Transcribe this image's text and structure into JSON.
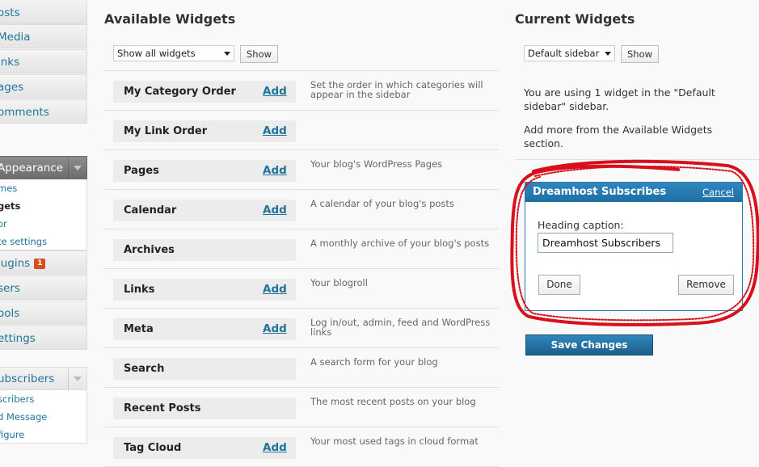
{
  "sidebar": {
    "items_top": [
      {
        "label": "Posts",
        "visible": "osts"
      },
      {
        "label": "Media",
        "visible": "Media"
      },
      {
        "label": "Links",
        "visible": "inks"
      },
      {
        "label": "Pages",
        "visible": "ages"
      },
      {
        "label": "Comments",
        "visible": "omments"
      }
    ],
    "appearance": {
      "label": "Appearance",
      "sub": [
        "mes",
        "gets",
        "or",
        "te settings"
      ]
    },
    "items_mid": [
      {
        "label": "Plugins",
        "visible": "lugins",
        "badge": "1"
      },
      {
        "label": "Users",
        "visible": "sers"
      },
      {
        "label": "Tools",
        "visible": "ools"
      },
      {
        "label": "Settings",
        "visible": "ettings"
      }
    ],
    "subscribers": {
      "label": "ubscribers",
      "sub": [
        "scribers",
        "d Message",
        "figure"
      ]
    }
  },
  "available": {
    "title": "Available Widgets",
    "filter_value": "Show all widgets",
    "show_label": "Show",
    "widgets": [
      {
        "name": "My Category Order",
        "add": "Add",
        "desc": "Set the order in which categories will appear in the sidebar"
      },
      {
        "name": "My Link Order",
        "add": "Add",
        "desc": ""
      },
      {
        "name": "Pages",
        "add": "Add",
        "desc": "Your blog's WordPress Pages"
      },
      {
        "name": "Calendar",
        "add": "Add",
        "desc": "A calendar of your blog's posts"
      },
      {
        "name": "Archives",
        "add": "",
        "desc": "A monthly archive of your blog's posts"
      },
      {
        "name": "Links",
        "add": "Add",
        "desc": "Your blogroll"
      },
      {
        "name": "Meta",
        "add": "Add",
        "desc": "Log in/out, admin, feed and WordPress links"
      },
      {
        "name": "Search",
        "add": "",
        "desc": "A search form for your blog"
      },
      {
        "name": "Recent Posts",
        "add": "",
        "desc": "The most recent posts on your blog"
      },
      {
        "name": "Tag Cloud",
        "add": "Add",
        "desc": "Your most used tags in cloud format"
      }
    ]
  },
  "current": {
    "title": "Current Widgets",
    "sidebar_value": "Default sidebar",
    "show_label": "Show",
    "info_1": "You are using 1 widget in the \"Default sidebar\" sidebar.",
    "info_2": "Add more from the Available Widgets section.",
    "widget": {
      "title": "Dreamhost Subscribes",
      "cancel": "Cancel",
      "heading_label": "Heading caption:",
      "heading_value": "Dreamhost Subscribers",
      "done": "Done",
      "remove": "Remove"
    },
    "save_label": "Save Changes"
  },
  "colors": {
    "link": "#21759b",
    "panel_header": "#2a7db4",
    "annotation": "#d8101c",
    "badge": "#d54e21"
  }
}
